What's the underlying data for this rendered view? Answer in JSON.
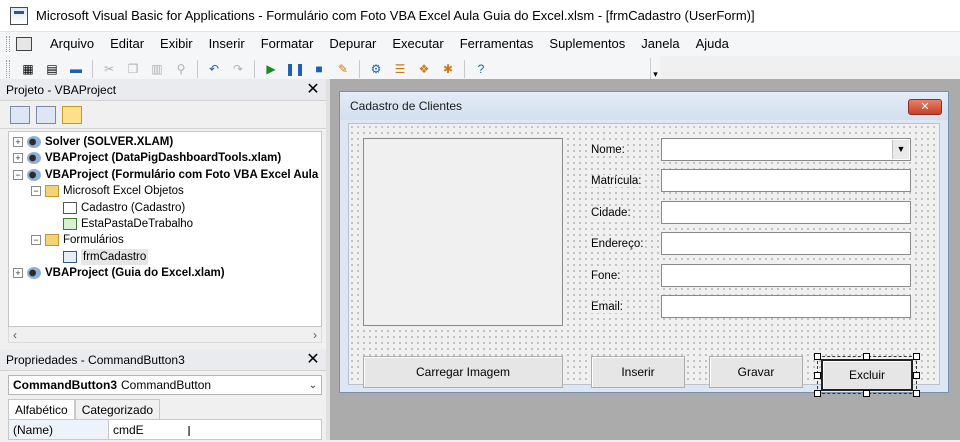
{
  "window": {
    "title": "Microsoft Visual Basic for Applications - Formulário com Foto VBA Excel Aula Guia do Excel.xlsm - [frmCadastro (UserForm)]"
  },
  "menu": {
    "items": [
      "Arquivo",
      "Editar",
      "Exibir",
      "Inserir",
      "Formatar",
      "Depurar",
      "Executar",
      "Ferramentas",
      "Suplementos",
      "Janela",
      "Ajuda"
    ]
  },
  "toolbar": {
    "buttons": [
      {
        "icon": "excel-view-icon",
        "glyph": "▦"
      },
      {
        "icon": "insert-userform-icon",
        "glyph": "▤"
      },
      {
        "icon": "save-icon",
        "glyph": "▬"
      },
      {
        "icon": "cut-icon",
        "glyph": "✂"
      },
      {
        "icon": "copy-icon",
        "glyph": "❐"
      },
      {
        "icon": "paste-icon",
        "glyph": "▥"
      },
      {
        "icon": "find-icon",
        "glyph": "⚲"
      },
      {
        "icon": "undo-icon",
        "glyph": "↶"
      },
      {
        "icon": "redo-icon",
        "glyph": "↷"
      },
      {
        "icon": "run-icon",
        "glyph": "▶"
      },
      {
        "icon": "break-icon",
        "glyph": "❚❚"
      },
      {
        "icon": "reset-icon",
        "glyph": "■"
      },
      {
        "icon": "design-mode-icon",
        "glyph": "✎"
      },
      {
        "icon": "project-explorer-icon",
        "glyph": "⚙"
      },
      {
        "icon": "properties-window-icon",
        "glyph": "☰"
      },
      {
        "icon": "object-browser-icon",
        "glyph": "❖"
      },
      {
        "icon": "toolbox-icon",
        "glyph": "✱"
      },
      {
        "icon": "help-icon",
        "glyph": "?"
      }
    ]
  },
  "project": {
    "title": "Projeto - VBAProject",
    "tree": [
      {
        "label": "Solver (SOLVER.XLAM)",
        "bold": true,
        "exp": "+",
        "icon": "vba",
        "indent": 0
      },
      {
        "label": "VBAProject (DataPigDashboardTools.xlam)",
        "bold": true,
        "exp": "+",
        "icon": "vba",
        "indent": 0
      },
      {
        "label": "VBAProject (Formulário com Foto VBA Excel Aula",
        "bold": true,
        "exp": "−",
        "icon": "vba",
        "indent": 0
      },
      {
        "label": "Microsoft Excel Objetos",
        "bold": false,
        "exp": "−",
        "icon": "folder",
        "indent": 1
      },
      {
        "label": "Cadastro (Cadastro)",
        "bold": false,
        "exp": "",
        "icon": "sheet",
        "indent": 2
      },
      {
        "label": "EstaPastaDeTrabalho",
        "bold": false,
        "exp": "",
        "icon": "sheet g",
        "indent": 2
      },
      {
        "label": "Formulários",
        "bold": false,
        "exp": "−",
        "icon": "folder",
        "indent": 1
      },
      {
        "label": "frmCadastro",
        "bold": false,
        "exp": "",
        "icon": "form",
        "indent": 2,
        "highlight": true
      },
      {
        "label": "VBAProject (Guia do Excel.xlam)",
        "bold": true,
        "exp": "+",
        "icon": "vba",
        "indent": 0
      }
    ]
  },
  "properties": {
    "title": "Propriedades - CommandButton3",
    "object_name": "CommandButton3",
    "object_type": "CommandButton",
    "tabs": [
      "Alfabético",
      "Categorizado"
    ],
    "rows": [
      {
        "name": "(Name)",
        "value": "cmdE"
      }
    ]
  },
  "form": {
    "caption": "Cadastro de Clientes",
    "close_glyph": "✕",
    "labels": [
      "Nome:",
      "Matrícula:",
      "Cidade:",
      "Endereço:",
      "Fone:",
      "Email:"
    ],
    "buttons": {
      "load_image": "Carregar Imagem",
      "insert": "Inserir",
      "save": "Gravar",
      "delete": "Excluir"
    }
  }
}
